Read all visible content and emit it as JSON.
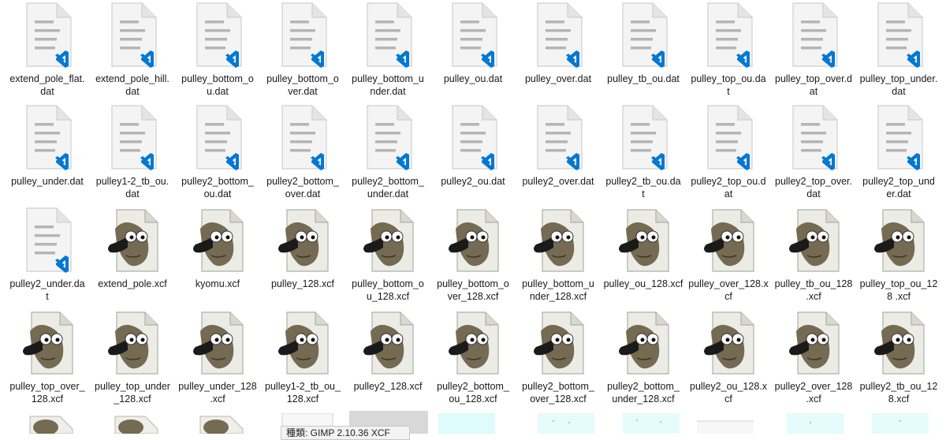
{
  "files": {
    "row1": [
      {
        "label": "extend_pole_flat.\ndat",
        "icon": "vscode-dat-file-icon"
      },
      {
        "label": "extend_pole_hill.\ndat",
        "icon": "vscode-dat-file-icon"
      },
      {
        "label": "pulley_bottom_o\nu.dat",
        "icon": "vscode-dat-file-icon"
      },
      {
        "label": "pulley_bottom_o\nver.dat",
        "icon": "vscode-dat-file-icon"
      },
      {
        "label": "pulley_bottom_u\nnder.dat",
        "icon": "vscode-dat-file-icon"
      },
      {
        "label": "pulley_ou.dat",
        "icon": "vscode-dat-file-icon"
      },
      {
        "label": "pulley_over.dat",
        "icon": "vscode-dat-file-icon"
      },
      {
        "label": "pulley_tb_ou.dat",
        "icon": "vscode-dat-file-icon"
      },
      {
        "label": "pulley_top_ou.da\nt",
        "icon": "vscode-dat-file-icon"
      },
      {
        "label": "pulley_top_over.d\nat",
        "icon": "vscode-dat-file-icon"
      },
      {
        "label": "pulley_top_under.\ndat",
        "icon": "vscode-dat-file-icon"
      }
    ],
    "row2": [
      {
        "label": "pulley_under.dat",
        "icon": "vscode-dat-file-icon"
      },
      {
        "label": "pulley1-2_tb_ou.\ndat",
        "icon": "vscode-dat-file-icon"
      },
      {
        "label": "pulley2_bottom_\nou.dat",
        "icon": "vscode-dat-file-icon"
      },
      {
        "label": "pulley2_bottom_\nover.dat",
        "icon": "vscode-dat-file-icon"
      },
      {
        "label": "pulley2_bottom_\nunder.dat",
        "icon": "vscode-dat-file-icon"
      },
      {
        "label": "pulley2_ou.dat",
        "icon": "vscode-dat-file-icon"
      },
      {
        "label": "pulley2_over.dat",
        "icon": "vscode-dat-file-icon"
      },
      {
        "label": "pulley2_tb_ou.da\nt",
        "icon": "vscode-dat-file-icon"
      },
      {
        "label": "pulley2_top_ou.d\nat",
        "icon": "vscode-dat-file-icon"
      },
      {
        "label": "pulley2_top_over.\ndat",
        "icon": "vscode-dat-file-icon"
      },
      {
        "label": "pulley2_top_und\ner.dat",
        "icon": "vscode-dat-file-icon"
      }
    ],
    "row3": [
      {
        "label": "pulley2_under.da\nt",
        "icon": "vscode-dat-file-icon"
      },
      {
        "label": "extend_pole.xcf",
        "icon": "gimp-xcf-file-icon"
      },
      {
        "label": "kyomu.xcf",
        "icon": "gimp-xcf-file-icon"
      },
      {
        "label": "pulley_128.xcf",
        "icon": "gimp-xcf-file-icon"
      },
      {
        "label": "pulley_bottom_o\nu_128.xcf",
        "icon": "gimp-xcf-file-icon"
      },
      {
        "label": "pulley_bottom_o\nver_128.xcf",
        "icon": "gimp-xcf-file-icon"
      },
      {
        "label": "pulley_bottom_u\nnder_128.xcf",
        "icon": "gimp-xcf-file-icon"
      },
      {
        "label": "pulley_ou_128.xcf",
        "icon": "gimp-xcf-file-icon"
      },
      {
        "label": "pulley_over_128.x\ncf",
        "icon": "gimp-xcf-file-icon"
      },
      {
        "label": "pulley_tb_ou_128\n.xcf",
        "icon": "gimp-xcf-file-icon"
      },
      {
        "label": "pulley_top_ou_12\n8 .xcf",
        "icon": "gimp-xcf-file-icon"
      }
    ],
    "row4": [
      {
        "label": "pulley_top_over_\n128.xcf",
        "icon": "gimp-xcf-file-icon"
      },
      {
        "label": "pulley_top_under\n_128.xcf",
        "icon": "gimp-xcf-file-icon"
      },
      {
        "label": "pulley_under_128\n.xcf",
        "icon": "gimp-xcf-file-icon"
      },
      {
        "label": "pulley1-2_tb_ou_\n128.xcf",
        "icon": "gimp-xcf-file-icon"
      },
      {
        "label": "pulley2_128.xcf",
        "icon": "gimp-xcf-file-icon"
      },
      {
        "label": "pulley2_bottom_\nou_128.xcf",
        "icon": "gimp-xcf-file-icon"
      },
      {
        "label": "pulley2_bottom_\nover_128.xcf",
        "icon": "gimp-xcf-file-icon"
      },
      {
        "label": "pulley2_bottom_\nunder_128.xcf",
        "icon": "gimp-xcf-file-icon"
      },
      {
        "label": "pulley2_ou_128.x\ncf",
        "icon": "gimp-xcf-file-icon"
      },
      {
        "label": "pulley2_over_128\n.xcf",
        "icon": "gimp-xcf-file-icon"
      },
      {
        "label": "pulley2_tb_ou_12\n8.xcf",
        "icon": "gimp-xcf-file-icon"
      }
    ]
  },
  "tooltip": {
    "text": "種類: GIMP 2.10.36 XCF"
  },
  "colors": {
    "vscode_blue": "#0078d4",
    "doc_lines": "#b5b5b5",
    "gimp_body": "#756a52"
  }
}
